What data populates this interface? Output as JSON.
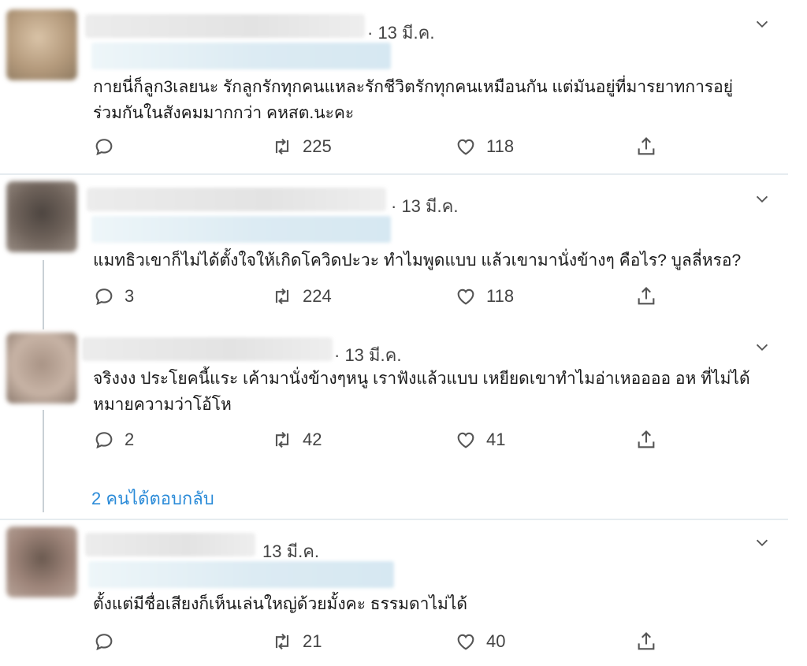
{
  "tweets": [
    {
      "time": "· 13 มี.ค.",
      "text_lines": [
        "กายนี่ก็ลูก3เลยนะ  รักลูกรักทุกคนแหละรักชีวิตรักทุกคนเหมือนกัน  แต่มันอยู่ที่มารยาทการอยู่",
        "ร่วมกันในสังคมมากกว่า คหสต.นะคะ"
      ],
      "replies": "",
      "retweets": "225",
      "likes": "118"
    },
    {
      "time": "· 13 มี.ค.",
      "text_lines": [
        "แมทธิวเขาก็ไม่ได้ตั้งใจให้เกิดโควิดปะวะ ทำไมพูดแบบ แล้วเขามานั่งข้างๆ คือไร? บูลลี่หรอ?"
      ],
      "replies": "3",
      "retweets": "224",
      "likes": "118"
    },
    {
      "time": "· 13 มี.ค.",
      "text_lines": [
        "จริงงง ประโยคนี้แระ เค้ามานั่งข้างๆหนู เราฟังแล้วแบบ เหยียดเขาทำไมอ่าเหออออ  อห ที่ไม่ได้",
        "หมายความว่าโอ้โห"
      ],
      "replies": "2",
      "retweets": "42",
      "likes": "41"
    },
    {
      "time": "13 มี.ค.",
      "text_lines": [
        "ตั้งแต่มีชื่อเสียงก็เห็นเล่นใหญ่ด้วยมั้งคะ ธรรมดาไม่ได้"
      ],
      "replies": "",
      "retweets": "21",
      "likes": "40"
    }
  ],
  "show_replies_label": "2 คนได้ตอบกลับ",
  "colors": {
    "link": "#2b8bd8",
    "icon": "#555555",
    "divider": "#e6ecf0"
  },
  "icons": [
    "reply-icon",
    "retweet-icon",
    "like-icon",
    "share-icon",
    "chevron-down-icon"
  ]
}
